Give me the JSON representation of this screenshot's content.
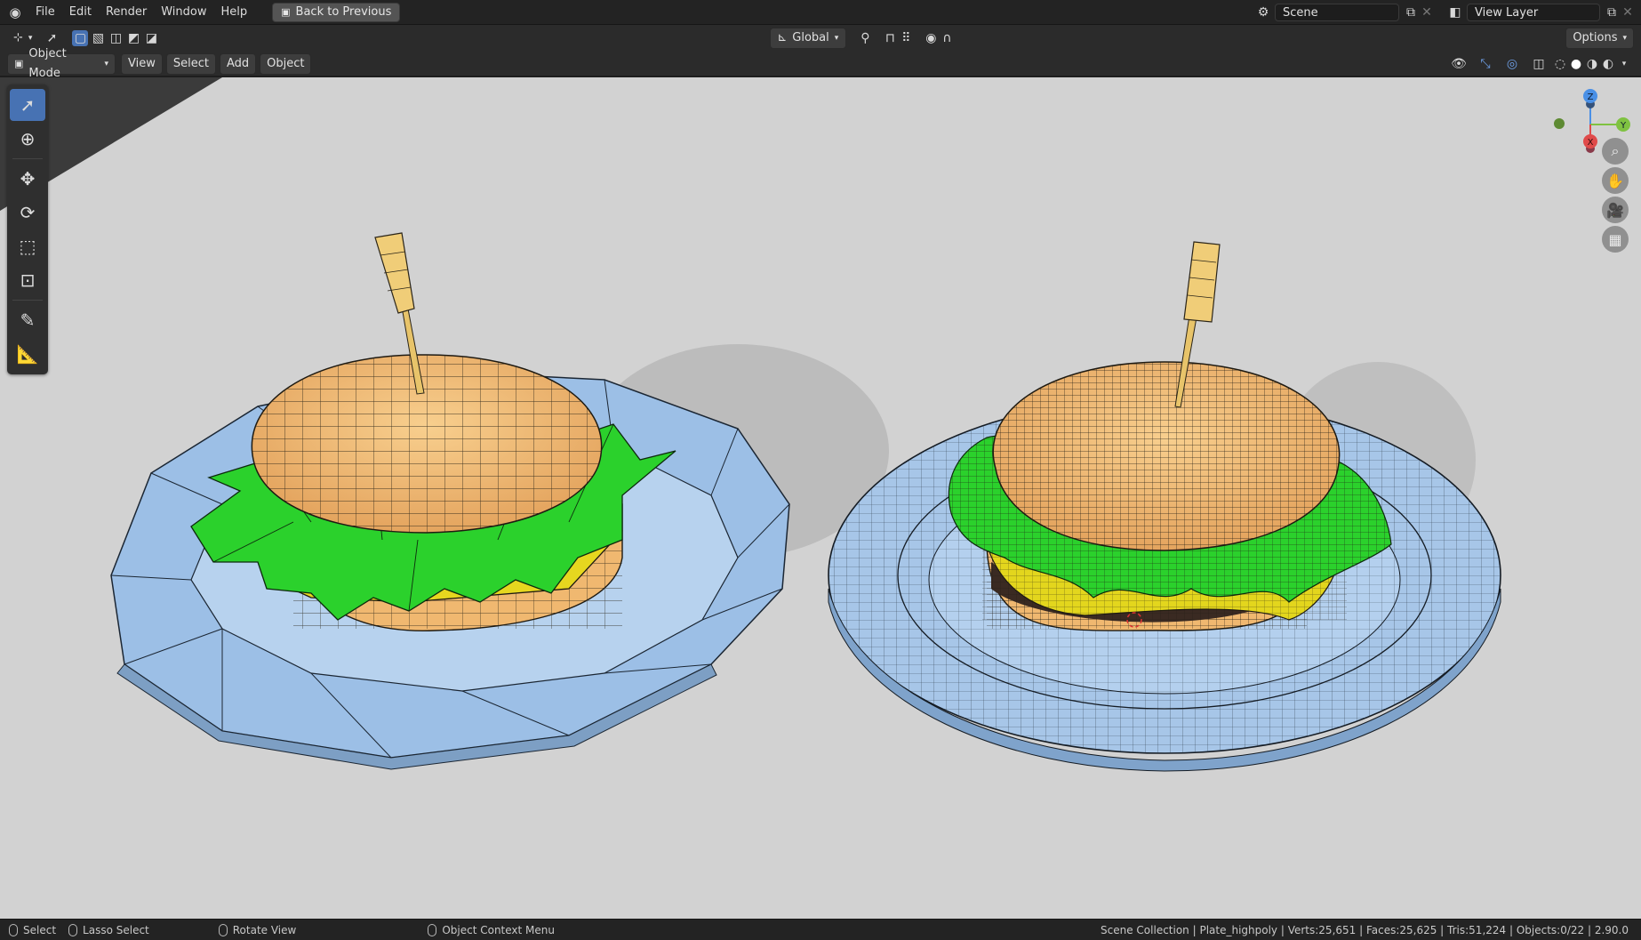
{
  "topbar": {
    "menus": [
      "File",
      "Edit",
      "Render",
      "Window",
      "Help"
    ],
    "back_button": "Back to Previous",
    "scene_field": "Scene",
    "view_layer_field": "View Layer"
  },
  "tool_header": {
    "orientation": "Global",
    "options_label": "Options"
  },
  "viewport_header": {
    "mode": "Object Mode",
    "menus": [
      "View",
      "Select",
      "Add",
      "Object"
    ]
  },
  "gizmo": {
    "axis_z": "Z",
    "axis_y": "Y",
    "axis_x": "X"
  },
  "statusbar": {
    "select": "Select",
    "lasso_select": "Lasso Select",
    "rotate_view": "Rotate View",
    "context_menu": "Object Context Menu",
    "stats": "Scene Collection | Plate_highpoly | Verts:25,651 | Faces:25,625 | Tris:51,224 | Objects:0/22 | 2.90.0"
  },
  "colors": {
    "accent": "#4772b3",
    "bun": "#f3bd73",
    "lettuce": "#29d12a",
    "cheese": "#e3d61d",
    "tomato": "#a3221c",
    "plate": "#a9c6e6"
  },
  "icons": [
    "blender-logo-icon",
    "editor-type-icon",
    "cursor-select-icon",
    "move-icon",
    "rotate-icon",
    "scale-icon",
    "transform-icon",
    "annotate-icon",
    "measure-icon",
    "zoom-icon",
    "hand-icon",
    "camera-icon",
    "grid-icon"
  ]
}
